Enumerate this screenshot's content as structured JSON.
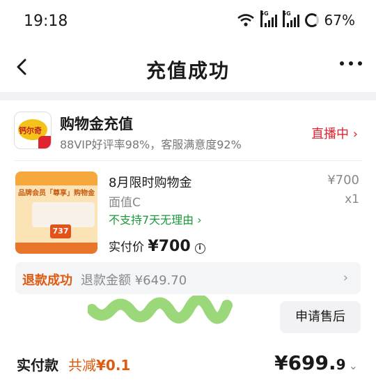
{
  "status_bar": {
    "time": "19:18",
    "network_1": "5G",
    "network_2": "5G",
    "battery": "67%"
  },
  "nav": {
    "title": "充值成功"
  },
  "shop": {
    "logo_text": "钙尔奇",
    "name": "购物金充值",
    "subtitle": "88VIP好评率98%，客服满意度92%",
    "live_label": "直播中",
    "live_arrow": "›"
  },
  "product": {
    "image_banner": "品牌会员「尊享」购物金",
    "image_price_tag": "737",
    "name": "8月限时购物金",
    "price": "¥700",
    "spec": "面值C",
    "quantity": "x1",
    "return_policy": "不支持7天无理由 ›",
    "paid_label": "实付价",
    "paid_value": "¥700",
    "info_symbol": "i"
  },
  "refund": {
    "status": "退款成功",
    "amount": "退款金额 ¥649.70",
    "arrow": "›"
  },
  "actions": {
    "after_sale": "申请售后"
  },
  "summary": {
    "label": "实付款",
    "discount_prefix": "共减",
    "discount_value": "¥0.1",
    "total_main": "¥699.",
    "total_decimal": "9",
    "chevron": "⌄"
  },
  "colors": {
    "accent_red": "#e0232f",
    "accent_orange": "#e05a10",
    "green": "#1a9a3a"
  }
}
